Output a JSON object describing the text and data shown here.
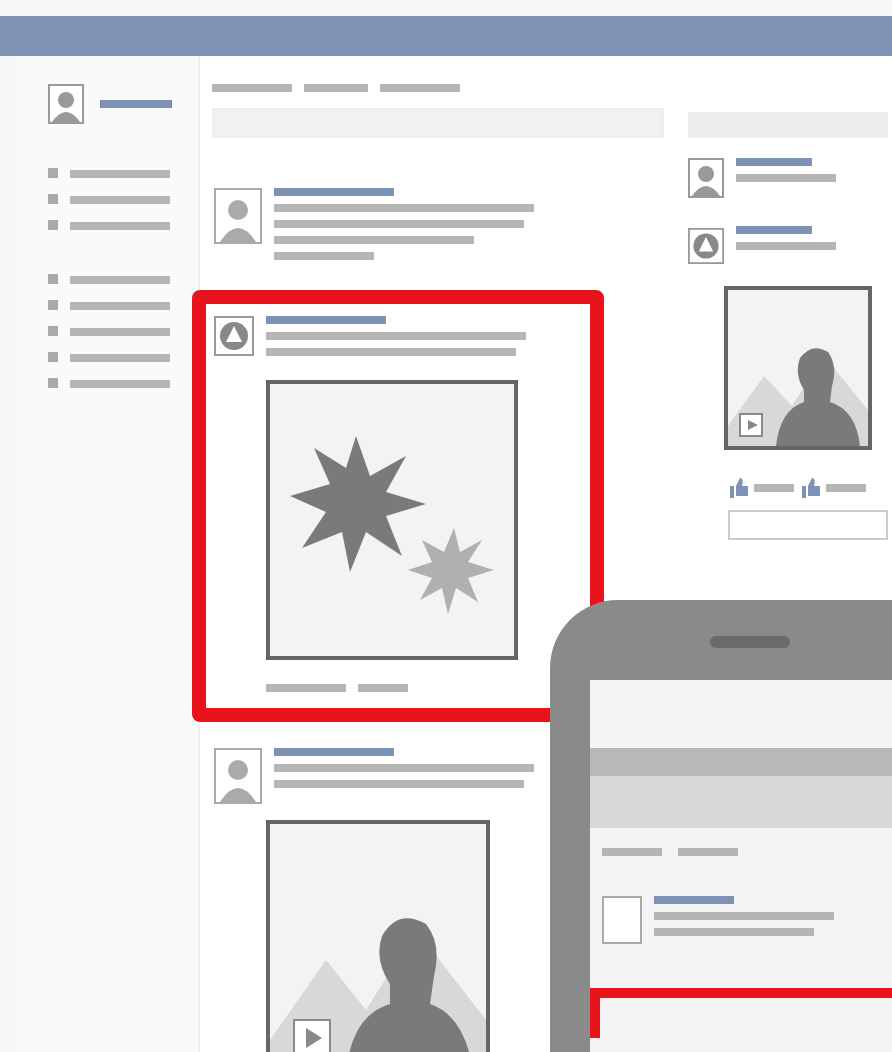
{
  "sidebar": {
    "profile": {
      "kind": "avatar"
    },
    "groups": [
      {
        "items": [
          {
            "kind": "link"
          },
          {
            "kind": "link"
          },
          {
            "kind": "link"
          }
        ]
      },
      {
        "items": [
          {
            "kind": "link"
          },
          {
            "kind": "link"
          },
          {
            "kind": "link"
          },
          {
            "kind": "link"
          },
          {
            "kind": "link"
          }
        ]
      }
    ]
  },
  "feed": {
    "posts": [
      {
        "kind": "text",
        "avatar": {
          "kind": "person"
        },
        "highlighted": false
      },
      {
        "kind": "image",
        "avatar": {
          "kind": "triangle"
        },
        "highlighted": true
      },
      {
        "kind": "photo",
        "avatar": {
          "kind": "person"
        },
        "highlighted": false
      }
    ]
  },
  "right_column": {
    "posts": [
      {
        "kind": "text",
        "avatar": {
          "kind": "person"
        }
      },
      {
        "kind": "photo",
        "avatar": {
          "kind": "triangle"
        }
      }
    ]
  },
  "phone": {
    "highlighted": true
  }
}
